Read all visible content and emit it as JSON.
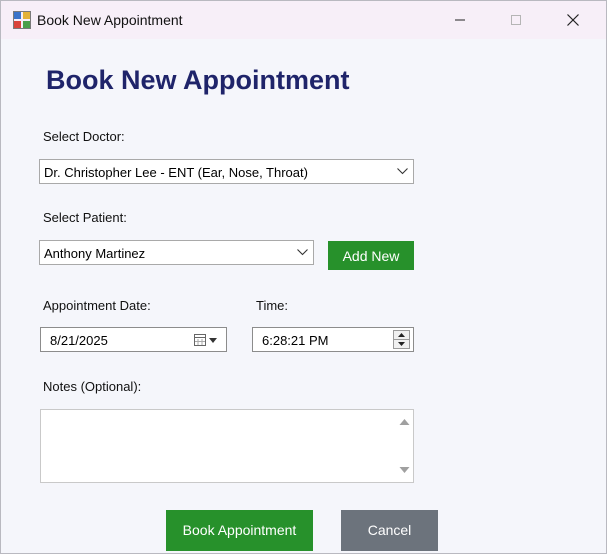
{
  "window": {
    "title": "Book New Appointment"
  },
  "form": {
    "heading": "Book New Appointment",
    "doctor_label": "Select Doctor:",
    "doctor_value": "Dr. Christopher Lee - ENT (Ear, Nose, Throat)",
    "patient_label": "Select Patient:",
    "patient_value": "Anthony Martinez",
    "add_new_label": "Add New",
    "date_label": "Appointment Date:",
    "date_value": "8/21/2025",
    "time_label": "Time:",
    "time_value": "6:28:21 PM",
    "notes_label": "Notes (Optional):",
    "notes_value": ""
  },
  "actions": {
    "book_label": "Book Appointment",
    "cancel_label": "Cancel"
  },
  "colors": {
    "heading": "#1f246a",
    "primary_button": "#27912b",
    "cancel_button": "#6c737c",
    "titlebar": "#f7eff8"
  },
  "icons": {
    "app": "app-icon",
    "minimize": "minimize-icon",
    "maximize": "maximize-icon",
    "close": "close-icon",
    "dropdown": "chevron-down-icon",
    "calendar": "calendar-icon",
    "spin_up": "spin-up-icon",
    "spin_down": "spin-down-icon",
    "scroll_up": "scroll-up-icon",
    "scroll_down": "scroll-down-icon"
  }
}
